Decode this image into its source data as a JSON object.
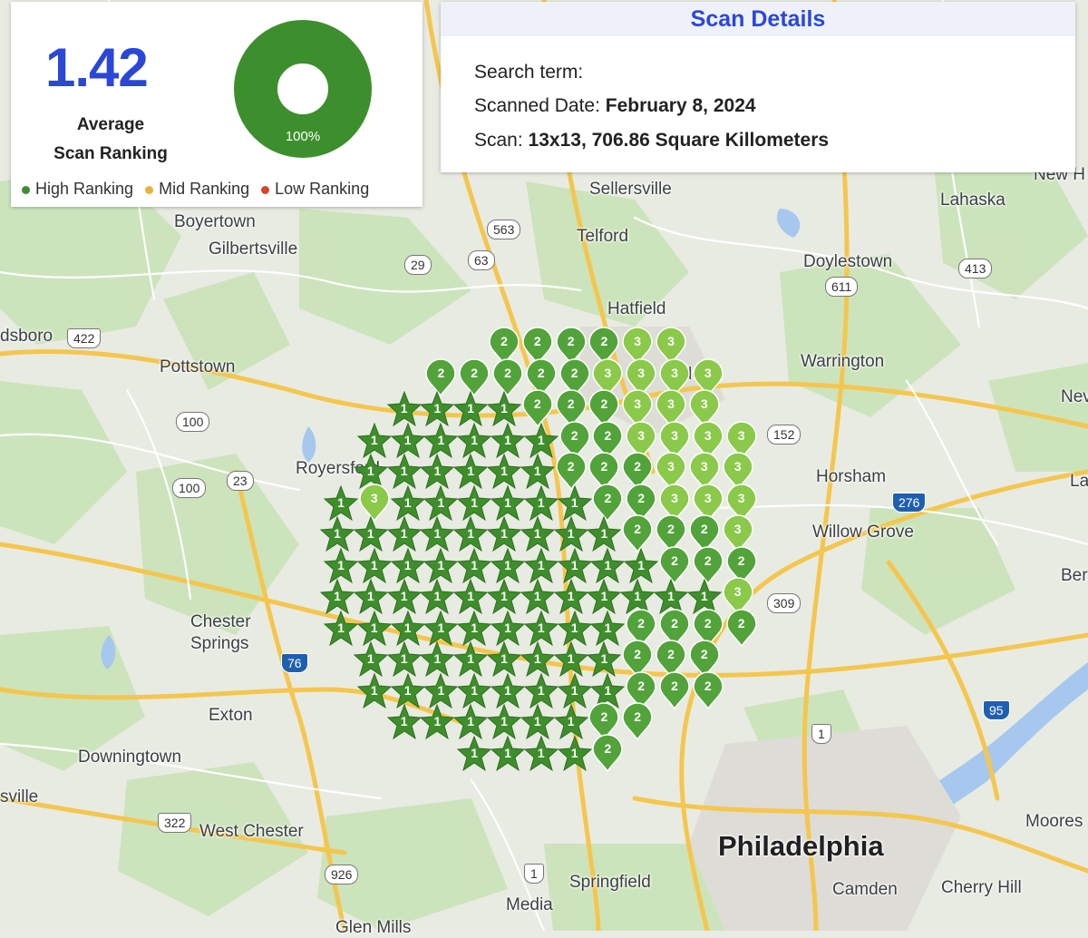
{
  "summary": {
    "average_ranking": "1.42",
    "average_label_line1": "Average",
    "average_label_line2": "Scan Ranking",
    "donut_percent": "100%",
    "legend": [
      {
        "label": "High Ranking",
        "color": "#3d8f2d"
      },
      {
        "label": "Mid Ranking",
        "color": "#e8b33c"
      },
      {
        "label": "Low Ranking",
        "color": "#d9432c"
      }
    ],
    "donut_color": "#3d8f2d"
  },
  "details": {
    "title": "Scan Details",
    "search_term_label": "Search term:",
    "search_term_value": "",
    "scanned_date_label": "Scanned Date:",
    "scanned_date_value": "February 8, 2024",
    "scan_label": "Scan:",
    "scan_value": "13x13, 706.86 Square Killometers"
  },
  "place_labels": [
    {
      "name": "Sellersville"
    },
    {
      "name": "Telford"
    },
    {
      "name": "Lahaska"
    },
    {
      "name": "Boyertown"
    },
    {
      "name": "Gilbertsville"
    },
    {
      "name": "Doylestown"
    },
    {
      "name": "Hatfield"
    },
    {
      "name": "dsboro"
    },
    {
      "name": "Pottstown"
    },
    {
      "name": "Warrington"
    },
    {
      "name": "Nev"
    },
    {
      "name": "Horsham"
    },
    {
      "name": "Willow Grove"
    },
    {
      "name": "Ber"
    },
    {
      "name": "La"
    },
    {
      "name": "Chester"
    },
    {
      "name": "Springs"
    },
    {
      "name": "Exton"
    },
    {
      "name": "Downingtown"
    },
    {
      "name": "sville"
    },
    {
      "name": "West Chester"
    },
    {
      "name": "Philadelphia"
    },
    {
      "name": "Springfield"
    },
    {
      "name": "Media"
    },
    {
      "name": "Camden"
    },
    {
      "name": "Cherry Hill"
    },
    {
      "name": "Moores"
    },
    {
      "name": "Glen Mills"
    },
    {
      "name": "Royersford"
    },
    {
      "name": "dale"
    },
    {
      "name": "New H"
    }
  ],
  "route_shields": [
    {
      "label": "563"
    },
    {
      "label": "63"
    },
    {
      "label": "29"
    },
    {
      "label": "422"
    },
    {
      "label": "611"
    },
    {
      "label": "413"
    },
    {
      "label": "100"
    },
    {
      "label": "23"
    },
    {
      "label": "100"
    },
    {
      "label": "152"
    },
    {
      "label": "276"
    },
    {
      "label": "76"
    },
    {
      "label": "1"
    },
    {
      "label": "95"
    },
    {
      "label": "322"
    },
    {
      "label": "926"
    },
    {
      "label": "1"
    },
    {
      "label": "309"
    }
  ],
  "grid_size": 13,
  "rank_colors": {
    "1": "#3e8e2b",
    "2": "#52a33a",
    "3": "#8bc94a"
  },
  "grid": [
    [
      0,
      0,
      0,
      0,
      0,
      2,
      2,
      2,
      2,
      3,
      3,
      0,
      0
    ],
    [
      0,
      0,
      0,
      2,
      2,
      2,
      2,
      2,
      3,
      3,
      3,
      3,
      0
    ],
    [
      0,
      0,
      1,
      1,
      1,
      1,
      2,
      2,
      2,
      3,
      3,
      3,
      0
    ],
    [
      0,
      1,
      1,
      1,
      1,
      1,
      1,
      2,
      2,
      3,
      3,
      3,
      3
    ],
    [
      0,
      1,
      1,
      1,
      1,
      1,
      1,
      2,
      2,
      2,
      3,
      3,
      3
    ],
    [
      1,
      3,
      1,
      1,
      1,
      1,
      1,
      1,
      2,
      2,
      3,
      3,
      3
    ],
    [
      1,
      1,
      1,
      1,
      1,
      1,
      1,
      1,
      1,
      2,
      2,
      2,
      3
    ],
    [
      1,
      1,
      1,
      1,
      1,
      1,
      1,
      1,
      1,
      1,
      2,
      2,
      2
    ],
    [
      1,
      1,
      1,
      1,
      1,
      1,
      1,
      1,
      1,
      1,
      1,
      1,
      3
    ],
    [
      1,
      1,
      1,
      1,
      1,
      1,
      1,
      1,
      1,
      2,
      2,
      2,
      2
    ],
    [
      0,
      1,
      1,
      1,
      1,
      1,
      1,
      1,
      1,
      2,
      2,
      2,
      0
    ],
    [
      0,
      1,
      1,
      1,
      1,
      1,
      1,
      1,
      1,
      2,
      2,
      2,
      0
    ],
    [
      0,
      0,
      1,
      1,
      1,
      1,
      1,
      1,
      2,
      2,
      0,
      0,
      0
    ],
    [
      0,
      0,
      0,
      0,
      1,
      1,
      1,
      1,
      2,
      0,
      0,
      0,
      0
    ]
  ]
}
